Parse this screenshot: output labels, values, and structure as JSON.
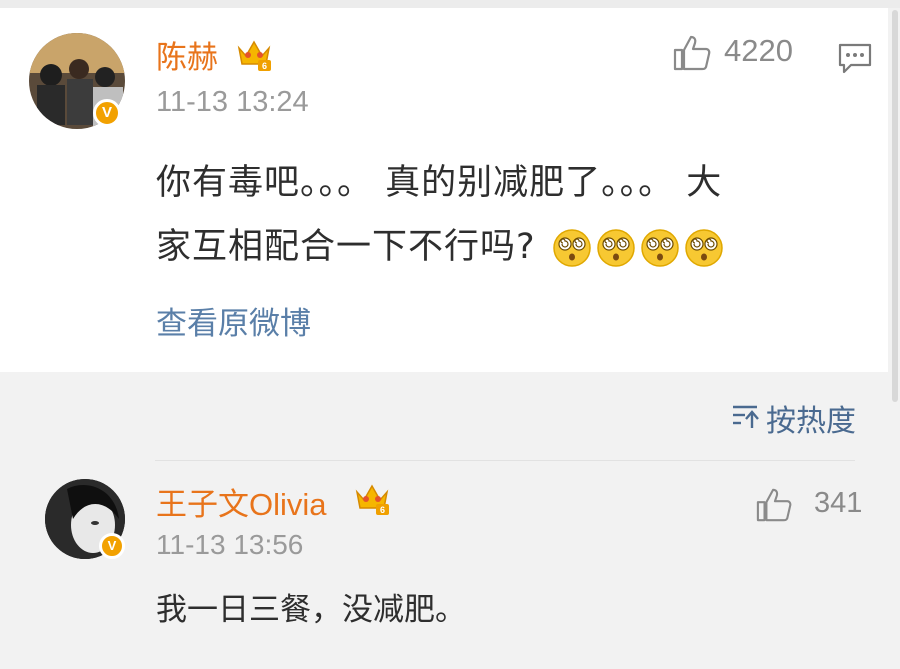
{
  "comment": {
    "author": "陈赫",
    "time": "11-13 13:24",
    "likes": "4220",
    "text_line1": "你有毒吧。。。 真的别减肥了。。。 大",
    "text_line2": "家互相配合一下不行吗?",
    "emoji_count": 4,
    "emoji_name": "dizzy-face",
    "view_original": "查看原微博"
  },
  "sort": {
    "label": "按热度"
  },
  "reply": {
    "author": "王子文Olivia",
    "time": "11-13 13:56",
    "likes": "341",
    "text": "我一日三餐，没减肥。"
  },
  "colors": {
    "name": "#e8741b",
    "link": "#5a7fa8",
    "badge": "#f2a100"
  }
}
